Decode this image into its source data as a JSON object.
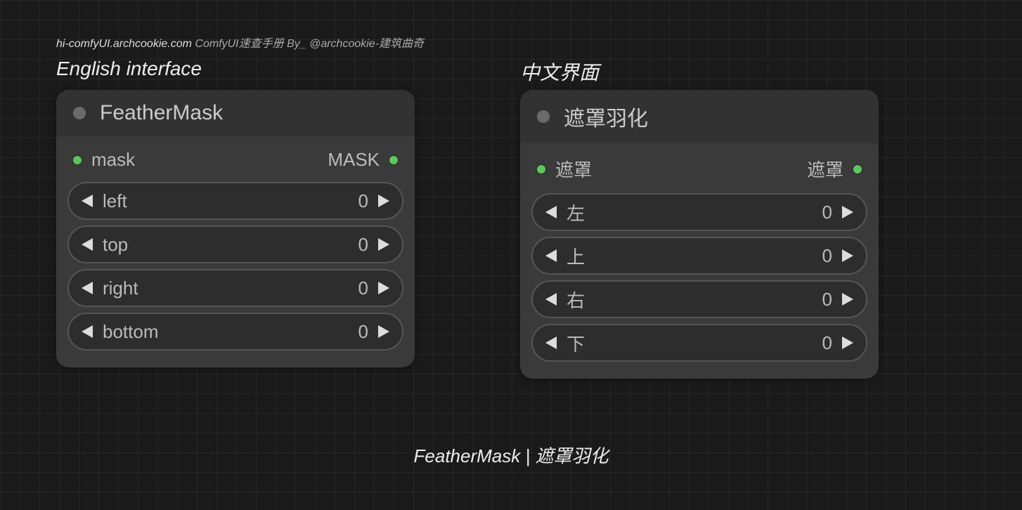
{
  "header": {
    "domain": "hi-comfyUI.archcookie.com",
    "subtitle": " ComfyUI速查手册  By_ @archcookie-建筑曲奇"
  },
  "labels": {
    "english": "English interface",
    "chinese": "中文界面"
  },
  "node_en": {
    "title": "FeatherMask",
    "input_label": "mask",
    "output_label": "MASK",
    "params": [
      {
        "label": "left",
        "value": "0"
      },
      {
        "label": "top",
        "value": "0"
      },
      {
        "label": "right",
        "value": "0"
      },
      {
        "label": "bottom",
        "value": "0"
      }
    ]
  },
  "node_cn": {
    "title": "遮罩羽化",
    "input_label": "遮罩",
    "output_label": "遮罩",
    "params": [
      {
        "label": "左",
        "value": "0"
      },
      {
        "label": "上",
        "value": "0"
      },
      {
        "label": "右",
        "value": "0"
      },
      {
        "label": "下",
        "value": "0"
      }
    ]
  },
  "caption": "FeatherMask | 遮罩羽化"
}
